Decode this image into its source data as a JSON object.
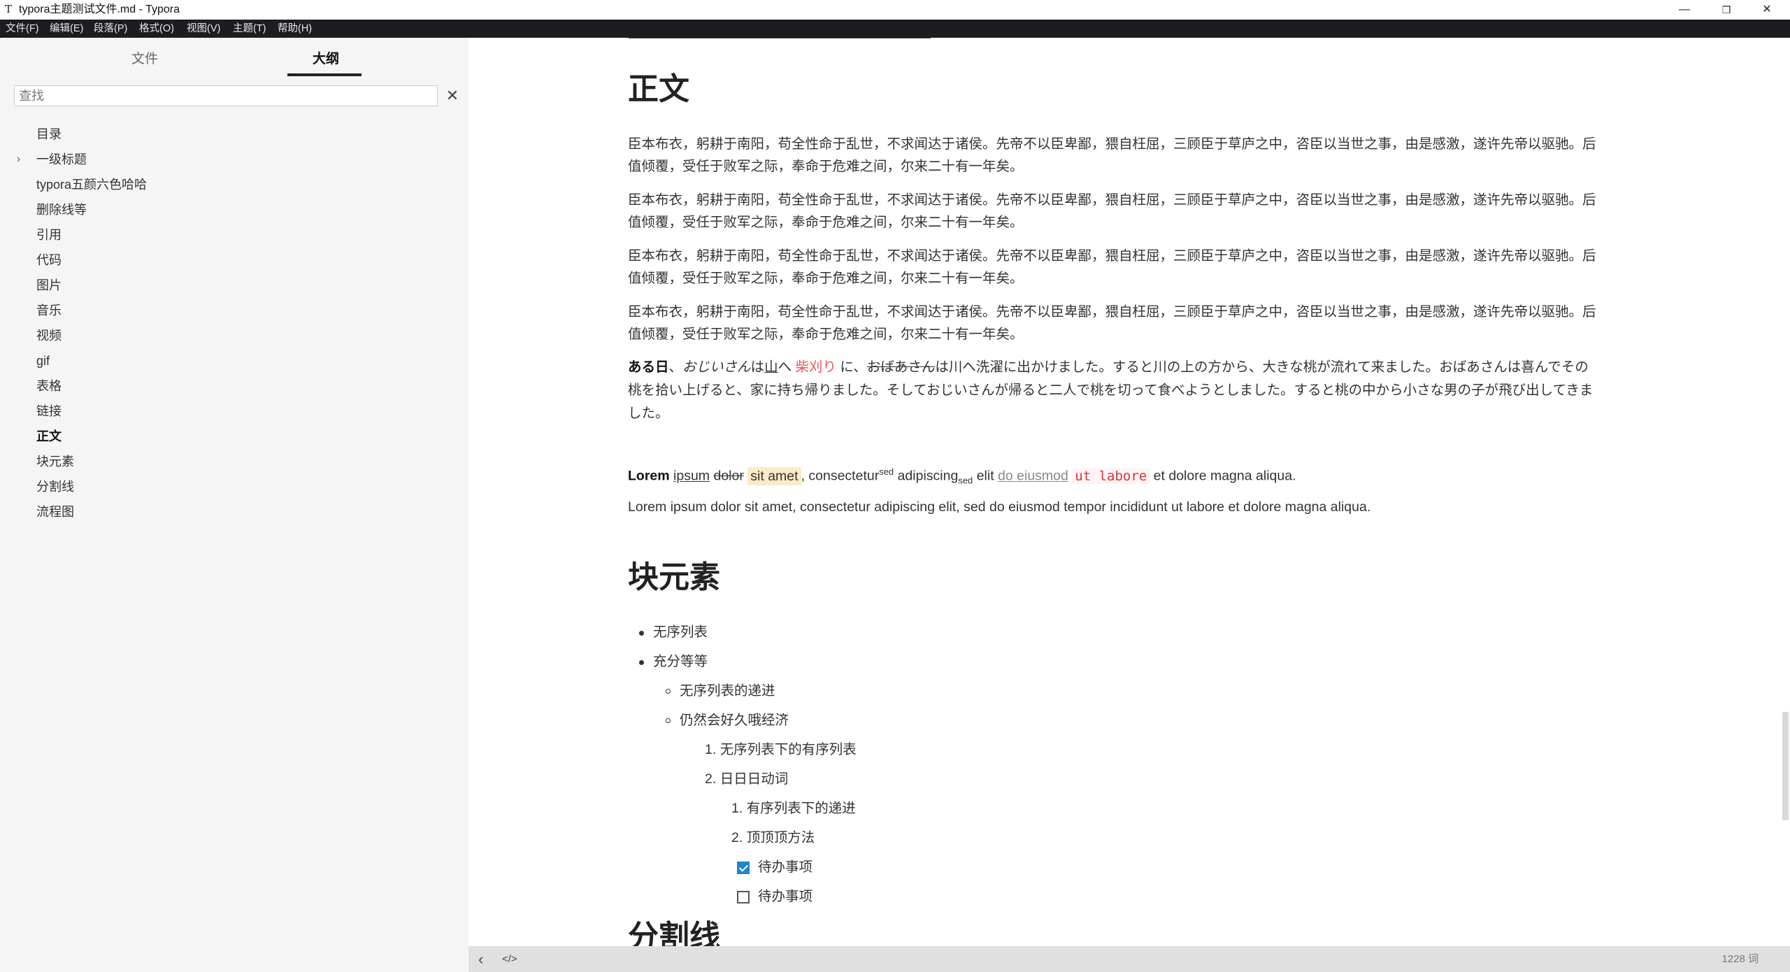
{
  "window": {
    "title": "typora主题测试文件.md - Typora",
    "app_icon_glyph": "T",
    "controls": {
      "minimize": "—",
      "restore": "❐",
      "close": "✕"
    }
  },
  "menubar": {
    "items": [
      "文件(F)",
      "编辑(E)",
      "段落(P)",
      "格式(O)",
      "视图(V)",
      "主题(T)",
      "帮助(H)"
    ]
  },
  "sidebar": {
    "tabs": {
      "files": "文件",
      "outline": "大纲",
      "active": "outline"
    },
    "search": {
      "placeholder": "查找",
      "value": "",
      "clear": "✕"
    },
    "outline": [
      {
        "label": "目录",
        "expandable": false
      },
      {
        "label": "一级标题",
        "expandable": true,
        "chevron": "›"
      },
      {
        "label": "typora五颜六色哈哈",
        "expandable": false
      },
      {
        "label": "删除线等",
        "expandable": false
      },
      {
        "label": "引用",
        "expandable": false
      },
      {
        "label": "代码",
        "expandable": false
      },
      {
        "label": "图片",
        "expandable": false
      },
      {
        "label": "音乐",
        "expandable": false
      },
      {
        "label": "视频",
        "expandable": false
      },
      {
        "label": "gif",
        "expandable": false
      },
      {
        "label": "表格",
        "expandable": false
      },
      {
        "label": "链接",
        "expandable": false
      },
      {
        "label": "正文",
        "expandable": false,
        "active": true
      },
      {
        "label": "块元素",
        "expandable": false
      },
      {
        "label": "分割线",
        "expandable": false
      },
      {
        "label": "流程图",
        "expandable": false
      }
    ]
  },
  "editor": {
    "h_body": "正文",
    "para_repeat_line1": "臣本布衣，躬耕于南阳，苟全性命于乱世，不求闻达于诸侯。先帝不以臣卑鄙，猥自枉屈，三顾臣于草庐之中，咨臣以当世之事，由是感激，遂许先帝以驱驰。后",
    "para_repeat_line2": "值倾覆，受任于败军之际，奉命于危难之间，尔来二十有一年矣。",
    "jp": {
      "bold": "ある日",
      "t1": "、",
      "italic": "おじいさん",
      "t2": "は",
      "underline": "山",
      "t3": "へ ",
      "red": "柴刈り",
      "t4": " に、",
      "strike": "おばあさん",
      "t5": "は川へ洗濯に出かけました。すると川の上の方から、大きな桃が流れて来ました。おばあさんは喜んでその",
      "line2": "桃を拾い上げると、家に持ち帰りました。そしておじいさんが帰ると二人で桃を切って食べようとしました。すると桃の中から小さな男の子が飛び出してきま",
      "line3": "した。"
    },
    "lorem1": {
      "bold": "Lorem",
      "underline": "ipsum",
      "strike": "dolor",
      "mark": "sit amet",
      "t1": ", consectetur",
      "sup": "sed",
      "t2": " adipiscing",
      "sub": "sed",
      "t3": " elit ",
      "link": "do eiusmod",
      "code": "ut labore",
      "t4": " et dolore magna aliqua."
    },
    "lorem2": "Lorem ipsum dolor sit amet, consectetur adipiscing elit, sed do eiusmod tempor incididunt ut labore et dolore magna aliqua.",
    "h_block": "块元素",
    "list": {
      "ul1": "无序列表",
      "ul2": "充分等等",
      "ul2_1": "无序列表的递进",
      "ul2_2": "仍然会好久哦经济",
      "ol1": "无序列表下的有序列表",
      "ol2": "日日日动词",
      "ol2_1": "有序列表下的递进",
      "ol2_2": "顶顶顶方法",
      "task1": "待办事项",
      "task1_checked": true,
      "task2": "待办事项",
      "task2_checked": false,
      "n1": "1.",
      "n2": "2."
    },
    "h_divider": "分割线"
  },
  "statusbar": {
    "back": "‹",
    "source": "</>",
    "wordcount": "1228 词"
  }
}
